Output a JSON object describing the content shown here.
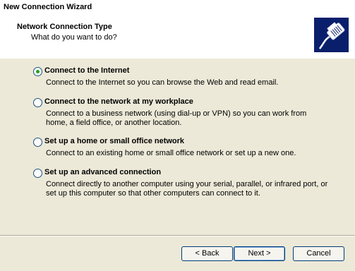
{
  "window": {
    "title": "New Connection Wizard"
  },
  "header": {
    "title": "Network Connection Type",
    "subtitle": "What do you want to do?",
    "icon": "network-cable-icon"
  },
  "options": [
    {
      "label": "Connect to the Internet",
      "description": "Connect to the Internet so you can browse the Web and read email.",
      "selected": true
    },
    {
      "label": "Connect to the network at my workplace",
      "description": "Connect to a business network (using dial-up or VPN) so you can work from home, a field office, or another location.",
      "selected": false
    },
    {
      "label": "Set up a home or small office network",
      "description": "Connect to an existing home or small office network or set up a new one.",
      "selected": false
    },
    {
      "label": "Set up an advanced connection",
      "description": "Connect directly to another computer using your serial, parallel, or infrared port, or set up this computer so that other computers can connect to it.",
      "selected": false
    }
  ],
  "buttons": {
    "back": "< Back",
    "next": "Next >",
    "cancel": "Cancel"
  },
  "colors": {
    "dialog_background": "#ece9d8",
    "radio_dot": "#21a121",
    "icon_background": "#0a1f6b"
  }
}
